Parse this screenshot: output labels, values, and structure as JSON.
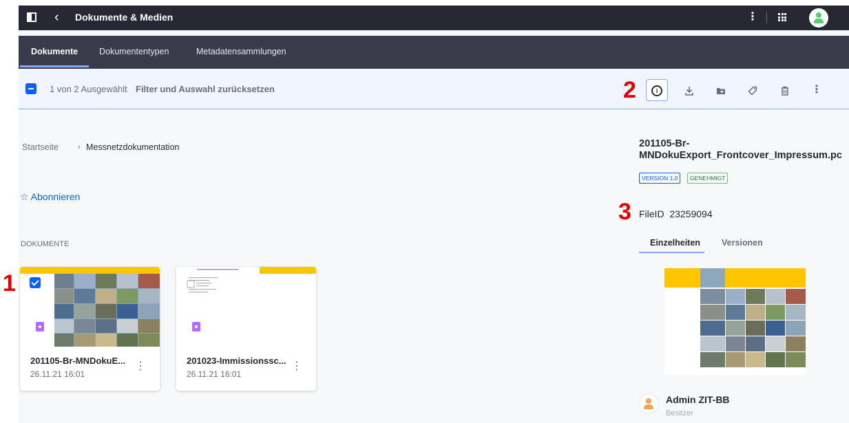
{
  "header": {
    "title": "Dokumente & Medien",
    "back_icon": "‹",
    "kebab_icon": "⋮"
  },
  "tabs": [
    {
      "label": "Dokumente",
      "active": true
    },
    {
      "label": "Dokumententypen"
    },
    {
      "label": "Metadatensammlungen"
    }
  ],
  "selection": {
    "count_text": "1 von 2 Ausgewählt",
    "reset_label": "Filter und Auswahl zurücksetzen"
  },
  "toolbar": {
    "icons": [
      "info-icon",
      "download-icon",
      "move-folder-icon",
      "tag-icon",
      "trash-icon",
      "more-icon"
    ]
  },
  "breadcrumb": {
    "home": "Startseite",
    "separator": "›",
    "current": "Messnetzdokumentation"
  },
  "subscribe_label": "☆ Abonnieren",
  "section_title": "DOKUMENTE",
  "documents": [
    {
      "title": "201105-Br-MNDokuE...",
      "date": "26.11.21 16:01",
      "selected": true
    },
    {
      "title": "201023-Immissionssc...",
      "date": "26.11.21 16:01",
      "selected": false
    }
  ],
  "panel": {
    "title_line1": "201105-Br-",
    "title_line2": "MNDokuExport_Frontcover_Impressum.pc",
    "version_badge": "VERSION 1.0",
    "status_badge": "GENEHMIGT",
    "fileid_label": "FileID",
    "fileid_value": "23259094",
    "tab_details": "Einzelheiten",
    "tab_versions": "Versionen",
    "owner_name": "Admin ZIT-BB",
    "owner_role": "Besitzer"
  },
  "markers": [
    "1",
    "2",
    "3"
  ],
  "colors": {
    "topbar": "#272833",
    "tabsbar": "#393a4a",
    "accent": "#0b5fff",
    "selection_bg": "#f0f5ff",
    "marker": "#e00000",
    "cover_yellow": "#ffc600"
  }
}
